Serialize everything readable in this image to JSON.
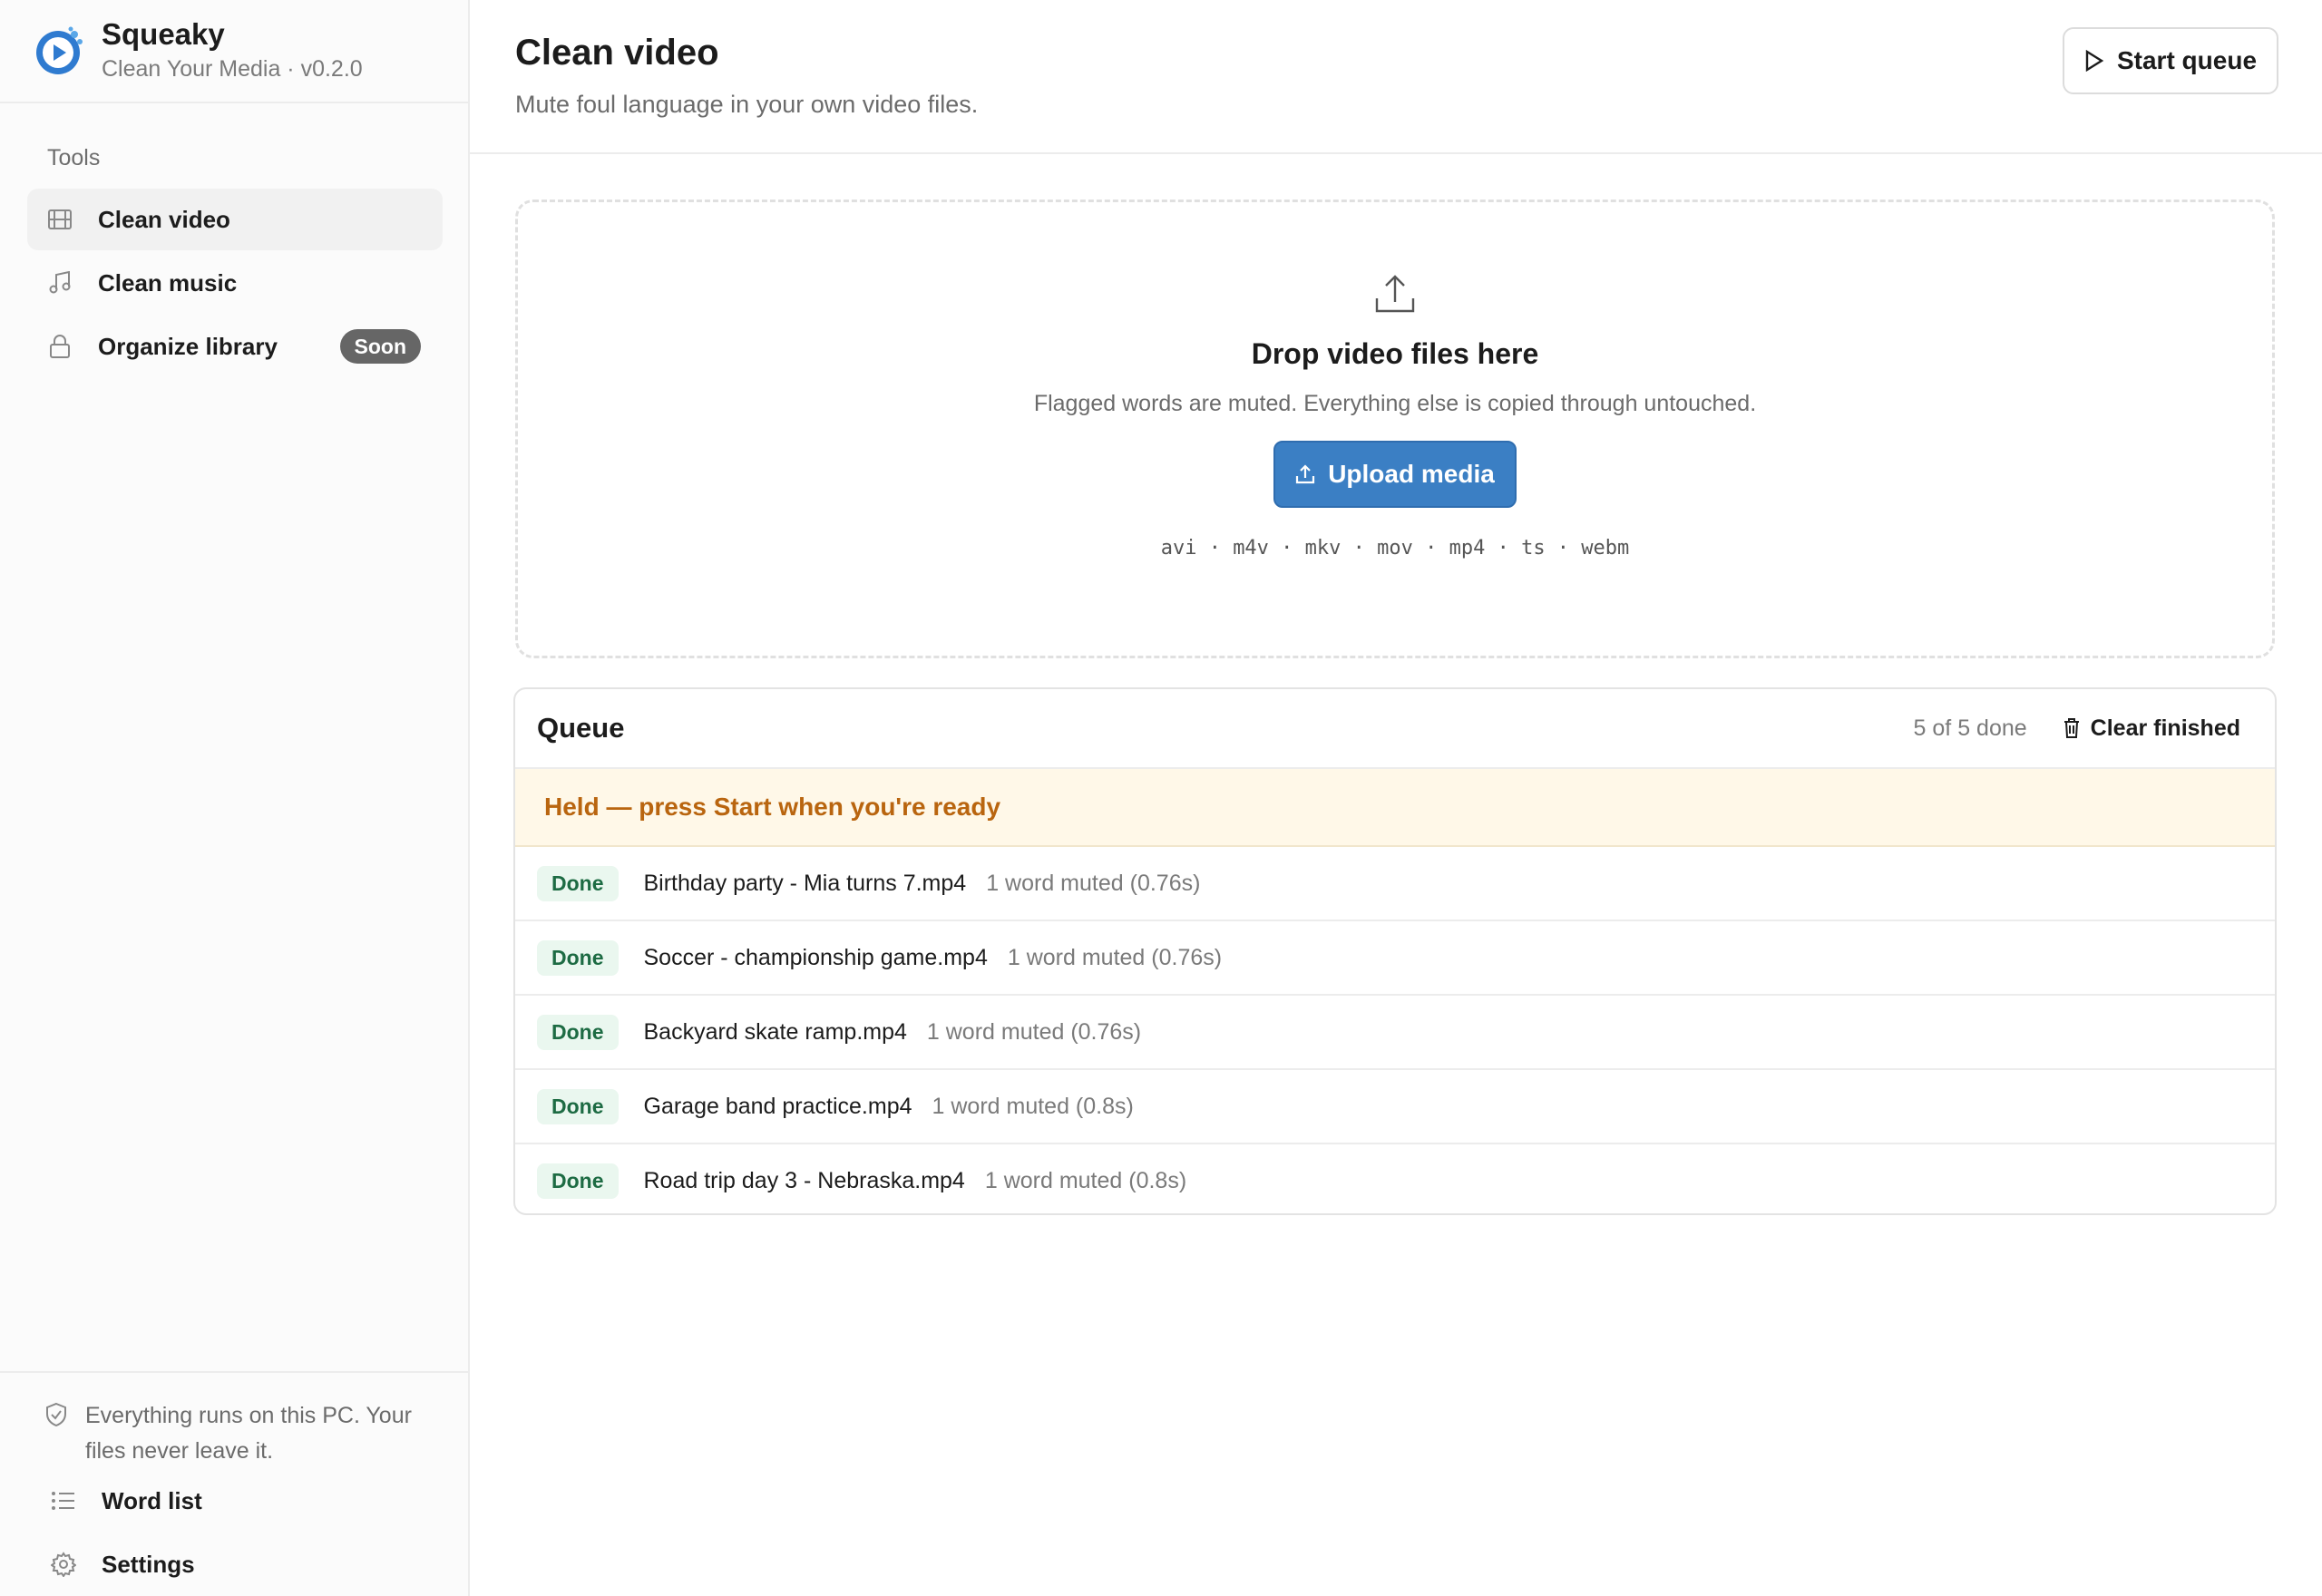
{
  "app": {
    "name": "Squeaky",
    "subtitle": "Clean Your Media · v0.2.0"
  },
  "sidebar": {
    "section_label": "Tools",
    "items": [
      {
        "label": "Clean video",
        "icon": "film-icon",
        "active": true
      },
      {
        "label": "Clean music",
        "icon": "music-note-icon"
      },
      {
        "label": "Organize library",
        "icon": "lock-icon",
        "badge": "Soon"
      }
    ],
    "privacy_note": "Everything runs on this PC. Your files never leave it.",
    "bottom_items": [
      {
        "label": "Word list",
        "icon": "list-icon"
      },
      {
        "label": "Settings",
        "icon": "gear-icon"
      }
    ]
  },
  "header": {
    "title": "Clean video",
    "subtitle": "Mute foul language in your own video files.",
    "start_label": "Start queue"
  },
  "dropzone": {
    "title": "Drop video files here",
    "subtitle": "Flagged words are muted. Everything else is copied through untouched.",
    "upload_label": "Upload media",
    "formats": "avi · m4v · mkv · mov · mp4 · ts · webm"
  },
  "queue": {
    "title": "Queue",
    "count": "5 of 5 done",
    "clear_label": "Clear finished",
    "held_message": "Held — press Start when you're ready",
    "rows": [
      {
        "status": "Done",
        "file": "Birthday party - Mia turns 7.mp4",
        "detail": "1 word muted (0.76s)"
      },
      {
        "status": "Done",
        "file": "Soccer - championship game.mp4",
        "detail": "1 word muted (0.76s)"
      },
      {
        "status": "Done",
        "file": "Backyard skate ramp.mp4",
        "detail": "1 word muted (0.76s)"
      },
      {
        "status": "Done",
        "file": "Garage band practice.mp4",
        "detail": "1 word muted (0.8s)"
      },
      {
        "status": "Done",
        "file": "Road trip day 3 - Nebraska.mp4",
        "detail": "1 word muted (0.8s)"
      }
    ]
  },
  "colors": {
    "accent": "#3b7fc4",
    "done_bg": "#eaf7ef",
    "done_text": "#1d6b43",
    "held_bg": "#fff8e8",
    "held_text": "#b9650f"
  }
}
